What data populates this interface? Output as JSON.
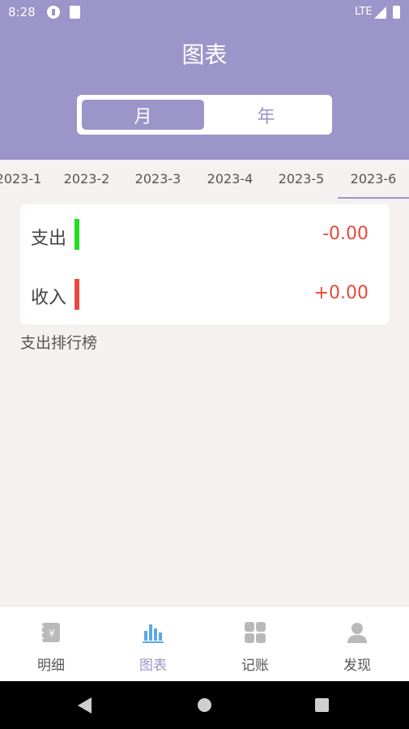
{
  "status_bar": {
    "time": "8:28",
    "network": "LTE"
  },
  "header": {
    "title": "图表"
  },
  "segment": {
    "month_label": "月",
    "year_label": "年",
    "selected": "月"
  },
  "month_tabs": {
    "items": [
      "2023-1",
      "2023-2",
      "2023-3",
      "2023-4",
      "2023-5",
      "2023-6"
    ],
    "active": "2023-6"
  },
  "summary": {
    "expense_label": "支出",
    "expense_value": "-0.00",
    "expense_color": "#22dd22",
    "income_label": "收入",
    "income_value": "+0.00",
    "income_color": "#e8493a"
  },
  "ranking": {
    "title": "支出排行榜"
  },
  "bottom_nav": {
    "items": [
      {
        "label": "明细",
        "icon": "ledger-icon"
      },
      {
        "label": "图表",
        "icon": "bar-chart-icon"
      },
      {
        "label": "记账",
        "icon": "grid-icon"
      },
      {
        "label": "发现",
        "icon": "user-icon"
      }
    ],
    "active": "图表"
  },
  "colors": {
    "accent": "#9b95c9",
    "active_nav_icon": "#5aa9e6",
    "inactive_icon": "#b9b9b9"
  }
}
